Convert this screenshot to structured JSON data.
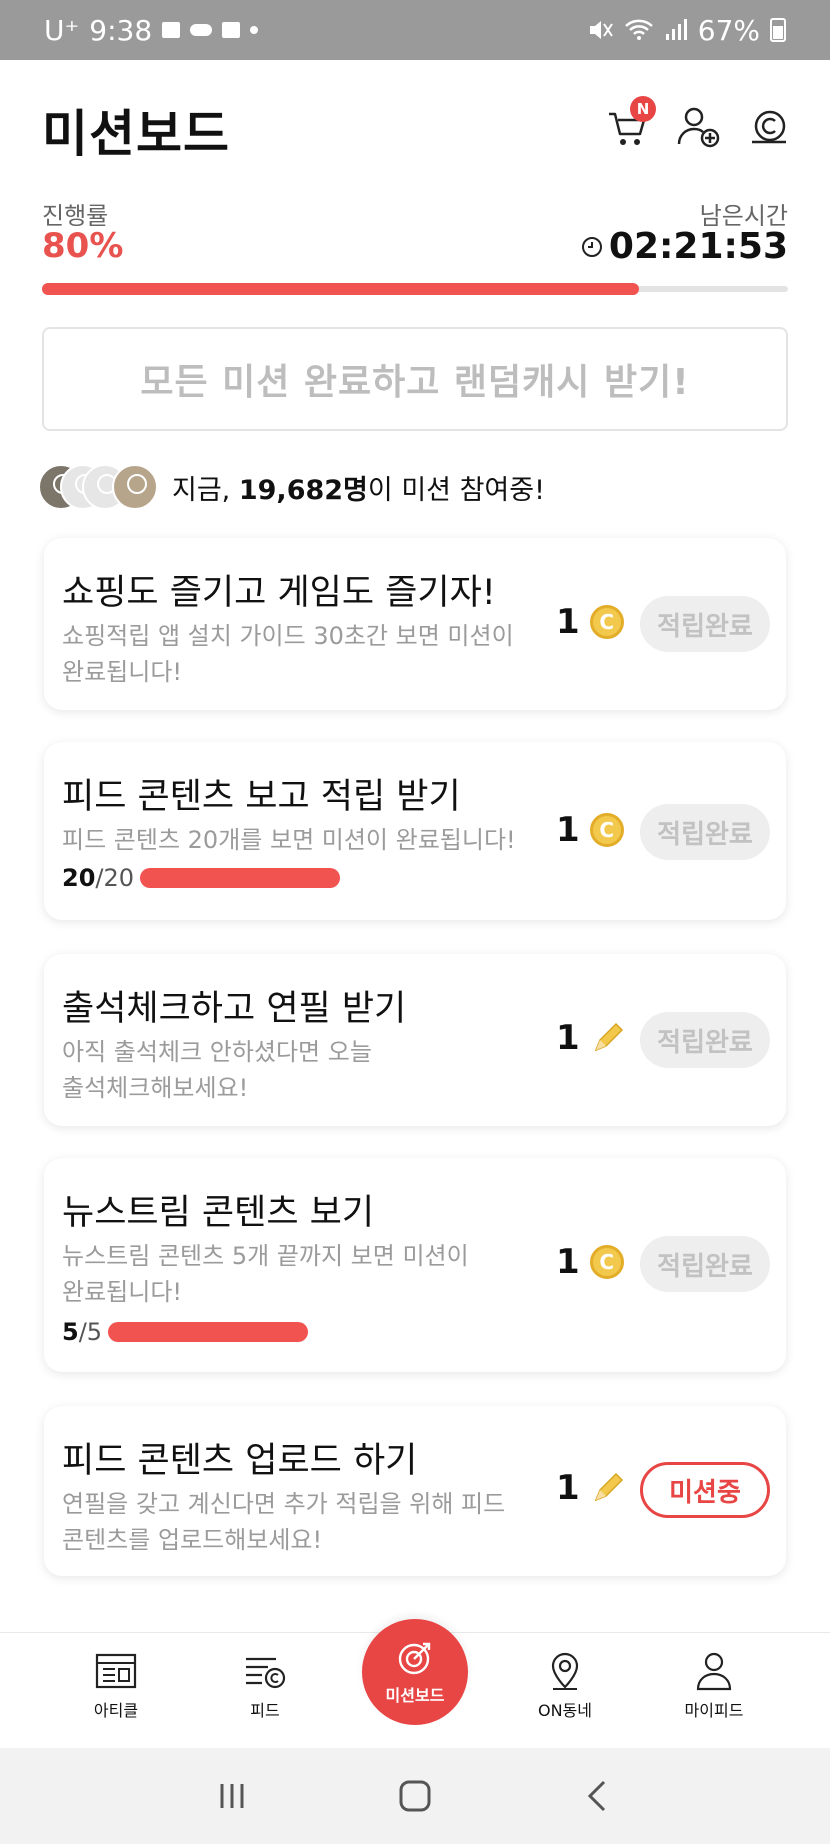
{
  "status_bar": {
    "carrier": "U⁺",
    "time": "9:38",
    "battery": "67%"
  },
  "header": {
    "title": "미션보드",
    "cart_badge": "N"
  },
  "progress": {
    "label": "진행률",
    "value": "80%",
    "fraction": 0.8,
    "time_label": "남은시간",
    "time_value": "02:21:53"
  },
  "banner": {
    "text": "모든 미션 완료하고 랜덤캐시 받기!"
  },
  "participants": {
    "prefix": "지금, ",
    "count": "19,682명",
    "suffix": "이 미션 참여중!"
  },
  "missions": [
    {
      "title": "쇼핑도 즐기고 게임도 즐기자!",
      "desc": "쇼핑적립 앱 설치 가이드 30초간 보면 미션이 완료됩니다!",
      "reward": "1",
      "reward_icon": "coin-icon",
      "status": "적립완료"
    },
    {
      "title": "피드 콘텐츠 보고 적립 받기",
      "desc": "피드 콘텐츠 20개를 보면 미션이 완료됩니다!",
      "count_done": "20",
      "count_total": "/20",
      "reward": "1",
      "reward_icon": "coin-icon",
      "status": "적립완료"
    },
    {
      "title": "출석체크하고 연필 받기",
      "desc": "아직 출석체크 안하셨다면 오늘 출석체크해보세요!",
      "reward": "1",
      "reward_icon": "pencil-icon",
      "status": "적립완료"
    },
    {
      "title": "뉴스트림 콘텐츠 보기",
      "desc": "뉴스트림 콘텐츠 5개 끝까지 보면 미션이 완료됩니다!",
      "count_done": "5",
      "count_total": "/5",
      "reward": "1",
      "reward_icon": "coin-icon",
      "status": "적립완료"
    },
    {
      "title": "피드 콘텐츠 업로드 하기",
      "desc": "연필을 갖고 계신다면 추가 적립을 위해 피드 콘텐츠를 업로드해보세요!",
      "reward": "1",
      "reward_icon": "pencil-icon",
      "status": "미션중"
    }
  ],
  "bottom_nav": {
    "items": [
      {
        "label": "아티클",
        "icon": "article-icon"
      },
      {
        "label": "피드",
        "icon": "feed-icon"
      },
      {
        "label": "미션보드",
        "icon": "target-icon"
      },
      {
        "label": "ON동네",
        "icon": "location-pin-icon"
      },
      {
        "label": "마이피드",
        "icon": "person-icon"
      }
    ]
  },
  "colors": {
    "accent": "#e84545",
    "progress": "#f05350",
    "disabled_text": "#c2c2c2"
  }
}
